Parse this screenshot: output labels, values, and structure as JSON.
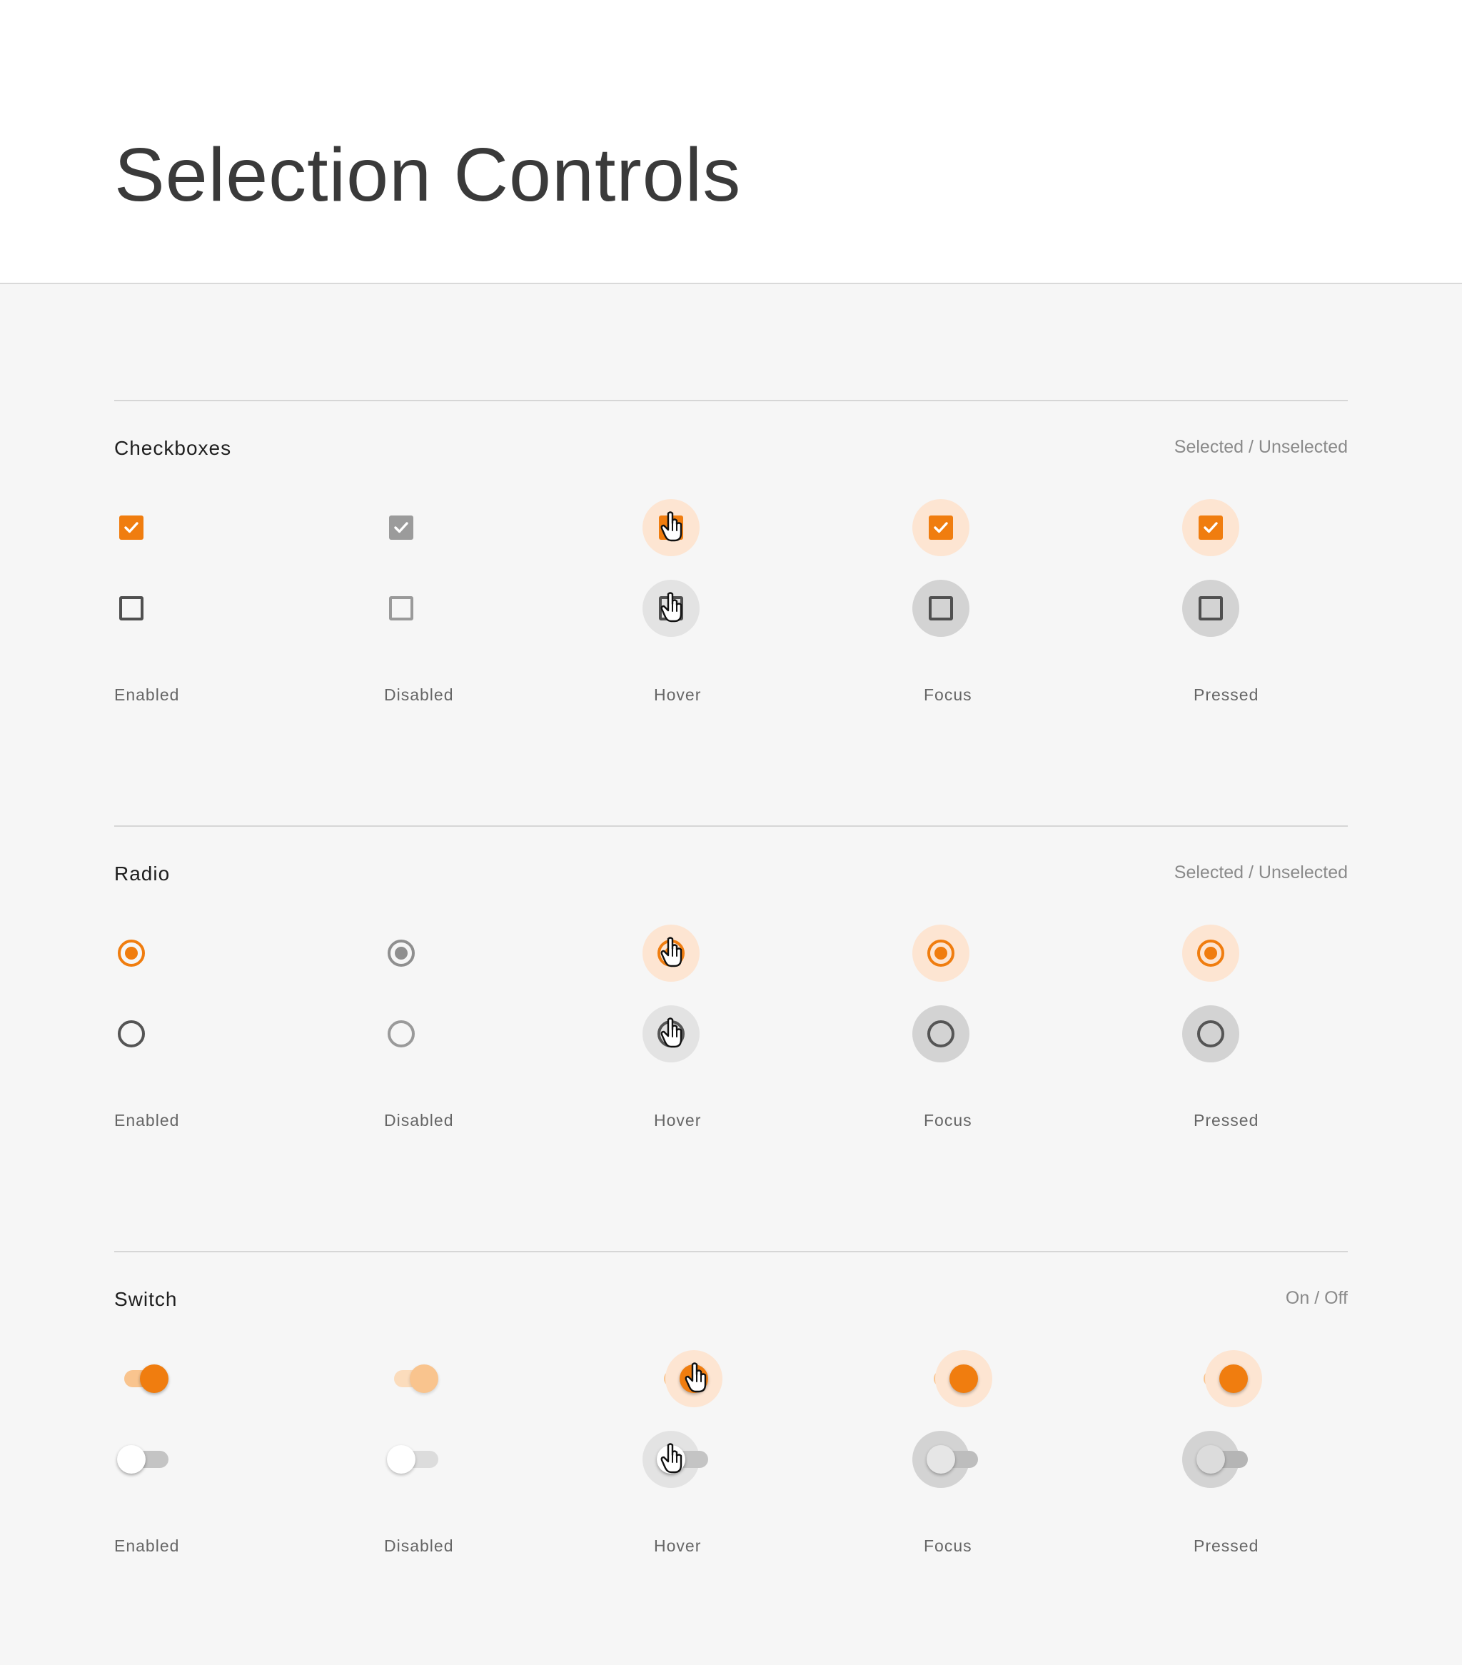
{
  "page": {
    "title": "Selection Controls"
  },
  "colors": {
    "accent": "#f07d0f",
    "accent_light": "#f9c48e",
    "halo_orange": "#fde5d2",
    "gray": "#9b9b9b"
  },
  "states": [
    "Enabled",
    "Disabled",
    "Hover",
    "Focus",
    "Pressed"
  ],
  "sections": {
    "checkboxes": {
      "title": "Checkboxes",
      "hint": "Selected / Unselected"
    },
    "radio": {
      "title": "Radio",
      "hint": "Selected / Unselected"
    },
    "switch": {
      "title": "Switch",
      "hint": "On / Off"
    }
  },
  "icons": {
    "check": "check-icon",
    "cursor": "hand-pointer-icon"
  }
}
